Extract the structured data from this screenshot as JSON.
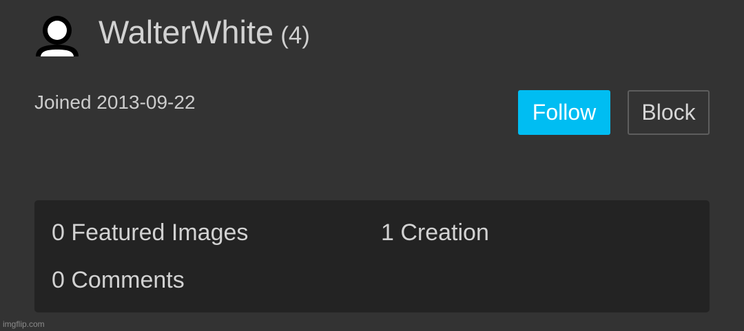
{
  "profile": {
    "username": "WalterWhite",
    "points": "(4)",
    "joined": "Joined 2013-09-22",
    "avatar_icon": "user-silhouette-icon"
  },
  "actions": {
    "follow_label": "Follow",
    "block_label": "Block",
    "follow_color": "#00bdf2"
  },
  "stats": {
    "featured_images": "0 Featured Images",
    "creations": "1 Creation",
    "comments": "0 Comments"
  },
  "watermark": "imgflip.com",
  "colors": {
    "background": "#333333",
    "panel": "#232323"
  }
}
